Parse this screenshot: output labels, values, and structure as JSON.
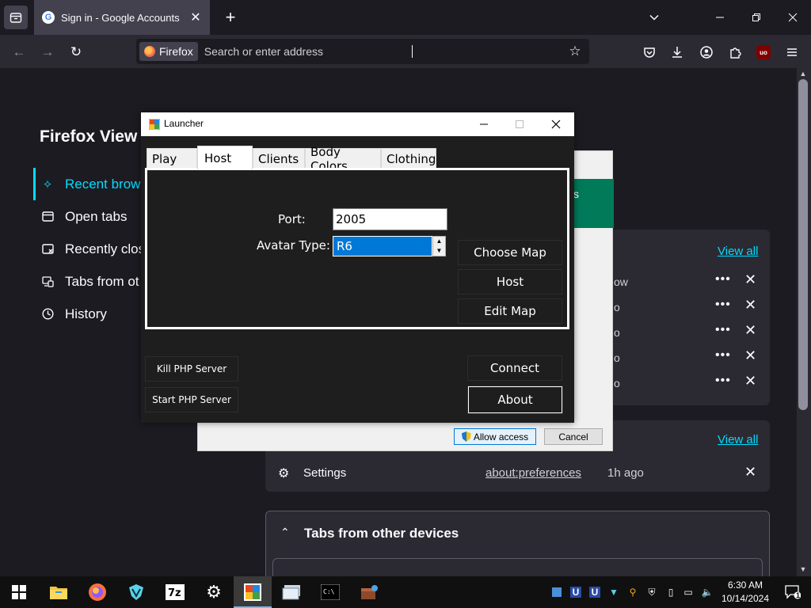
{
  "browser": {
    "tab": {
      "title": "Sign in - Google Accounts",
      "favicon": "G"
    },
    "urlbar": {
      "identity_label": "Firefox",
      "placeholder": "Search or enter address"
    }
  },
  "firefox_view": {
    "title": "Firefox View",
    "nav": [
      {
        "label": "Recent brows",
        "icon": "sparkle-icon",
        "active": true
      },
      {
        "label": "Open tabs",
        "icon": "tab-icon"
      },
      {
        "label": "Recently clos",
        "icon": "closed-tab-icon"
      },
      {
        "label": "Tabs from ot",
        "icon": "synced-tabs-icon"
      },
      {
        "label": "History",
        "icon": "history-icon"
      }
    ],
    "open_tabs_card": {
      "view_all": "View all",
      "row_fragments": [
        "ow",
        "o",
        "o",
        "o",
        "o"
      ]
    },
    "recently_closed_card": {
      "view_all": "View all",
      "row": {
        "label": "Settings",
        "url": "about:preferences",
        "time": "1h ago"
      }
    },
    "tabs_other_devices": {
      "title": "Tabs from other devices"
    },
    "banner_fragment": "s"
  },
  "permission_dialog": {
    "allow_label": "Allow access",
    "cancel_label": "Cancel"
  },
  "launcher": {
    "title": "Launcher",
    "tabs": [
      "Play",
      "Host",
      "Clients",
      "Body Colors",
      "Clothing"
    ],
    "active_tab": "Host",
    "host": {
      "port_label": "Port:",
      "port_value": "2005",
      "avatar_label": "Avatar Type:",
      "avatar_value": "R6",
      "choose_map": "Choose Map",
      "host": "Host",
      "edit_map": "Edit Map"
    },
    "kill_php": "Kill PHP Server",
    "start_php": "Start PHP Server",
    "connect": "Connect",
    "about": "About"
  },
  "taskbar": {
    "time": "6:30 AM",
    "date": "10/14/2024",
    "notification_count": "1"
  },
  "colors": {
    "accent": "#00ddff",
    "selection": "#0078d7",
    "banner_green": "#017a5a"
  }
}
